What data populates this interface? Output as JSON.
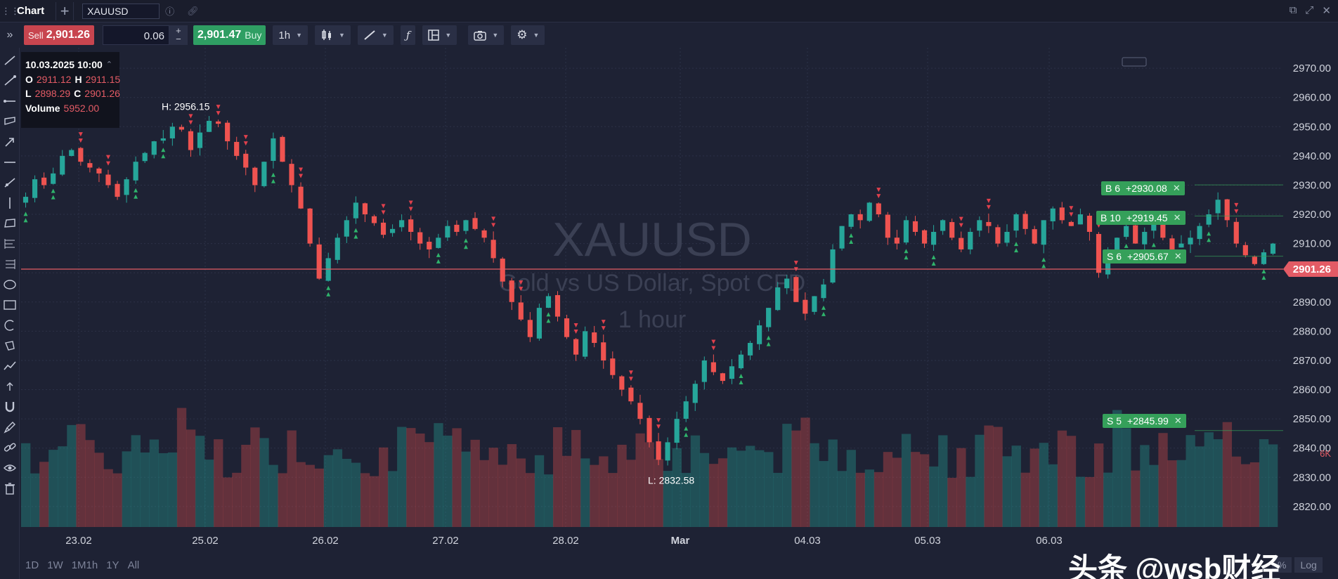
{
  "titlebar": {
    "app_name": "Chart",
    "symbol": "XAUUSD"
  },
  "toolbar": {
    "sell_label": "Sell",
    "sell_price": "2,901.26",
    "quantity": "0.06",
    "buy_price": "2,901.47",
    "buy_label": "Buy",
    "timeframe": "1h"
  },
  "ohlc": {
    "timestamp": "10.03.2025 10:00",
    "o_label": "O",
    "o": "2911.12",
    "h_label": "H",
    "h": "2911.15",
    "l_label": "L",
    "l": "2898.29",
    "c_label": "C",
    "c": "2901.26",
    "volume_label": "Volume",
    "volume": "5952.00"
  },
  "watermark": {
    "symbol": "XAUUSD",
    "description": "Gold vs US Dollar, Spot CFD",
    "interval": "1 hour"
  },
  "orders": [
    {
      "side": "B 6",
      "pnl": "+2930.08",
      "price": 2930.08
    },
    {
      "side": "B 10",
      "pnl": "+2919.45",
      "price": 2919.45
    },
    {
      "side": "S 6",
      "pnl": "+2905.67",
      "price": 2905.67
    },
    {
      "side": "S 5",
      "pnl": "+2845.99",
      "price": 2845.99
    }
  ],
  "periods": [
    "1D",
    "1W",
    "1M",
    "1h",
    "1Y",
    "All"
  ],
  "scale_options": [
    "%",
    "Log"
  ],
  "volume_axis_label": "6K",
  "credit": "头条 @wsb财经",
  "colors": {
    "bull": "#26a69a",
    "bear": "#ef5350",
    "current_price": "#e35b65",
    "order": "#35a05a"
  },
  "chart_data": {
    "type": "candlestick",
    "symbol": "XAUUSD",
    "interval": "1 hour",
    "current_price": 2901.26,
    "ylim": [
      2813,
      2977
    ],
    "y_ticks": [
      2970,
      2960,
      2950,
      2940,
      2930,
      2920,
      2910,
      2900,
      2890,
      2880,
      2870,
      2860,
      2850,
      2840,
      2830,
      2820
    ],
    "x_ticks": [
      "23.02",
      "25.02",
      "26.02",
      "27.02",
      "28.02",
      "Mar",
      "04.03",
      "05.03",
      "06.03"
    ],
    "annotations": [
      {
        "text": "H: 2956.15",
        "value": 2956.15
      },
      {
        "text": "L: 2832.58",
        "value": 2832.58
      }
    ],
    "close_path": [
      2926,
      2932,
      2930,
      2934,
      2940,
      2942,
      2938,
      2936,
      2934,
      2930,
      2926,
      2932,
      2938,
      2941,
      2945,
      2946,
      2950,
      2949,
      2942,
      2948,
      2952,
      2951,
      2945,
      2940,
      2936,
      2930,
      2938,
      2946,
      2938,
      2930,
      2922,
      2910,
      2898,
      2905,
      2912,
      2918,
      2924,
      2920,
      2917,
      2913,
      2915,
      2918,
      2914,
      2910,
      2908,
      2912,
      2916,
      2914,
      2918,
      2915,
      2912,
      2905,
      2897,
      2890,
      2884,
      2878,
      2888,
      2892,
      2885,
      2878,
      2872,
      2880,
      2876,
      2870,
      2865,
      2860,
      2856,
      2850,
      2842,
      2836,
      2842,
      2850,
      2856,
      2862,
      2870,
      2866,
      2863,
      2868,
      2872,
      2876,
      2882,
      2888,
      2895,
      2898,
      2890,
      2886,
      2892,
      2896,
      2908,
      2916,
      2920,
      2918,
      2924,
      2920,
      2912,
      2910,
      2918,
      2914,
      2910,
      2914,
      2918,
      2912,
      2908,
      2914,
      2918,
      2916,
      2910,
      2914,
      2920,
      2915,
      2910,
      2918,
      2922,
      2918,
      2916,
      2920,
      2914,
      2900,
      2908,
      2912,
      2916,
      2910,
      2914,
      2918,
      2912,
      2908,
      2910,
      2912,
      2916,
      2920,
      2925,
      2918,
      2910,
      2906,
      2903,
      2907,
      2910
    ]
  }
}
